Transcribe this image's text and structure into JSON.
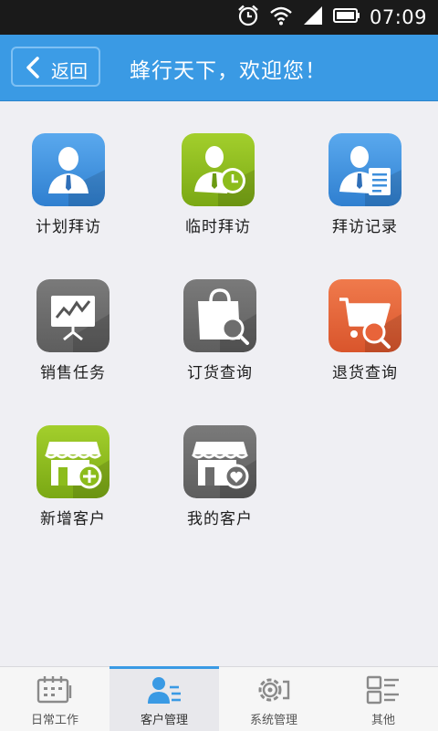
{
  "status_bar": {
    "time": "07:09",
    "icons": [
      "alarm-icon",
      "wifi-icon",
      "signal-icon",
      "battery-icon"
    ]
  },
  "header": {
    "back_label": "返回",
    "title": "蜂行天下，欢迎您！",
    "color": "#3a9ae4"
  },
  "tiles": [
    {
      "label": "计划拜访",
      "icon": "planned-visit-icon",
      "color": "#3d8fdc"
    },
    {
      "label": "临时拜访",
      "icon": "temporary-visit-icon",
      "color": "#8cbc1c"
    },
    {
      "label": "拜访记录",
      "icon": "visit-record-icon",
      "color": "#3d8fdc"
    },
    {
      "label": "销售任务",
      "icon": "sales-task-icon",
      "color": "#6d6d6d"
    },
    {
      "label": "订货查询",
      "icon": "order-query-icon",
      "color": "#6d6d6d"
    },
    {
      "label": "退货查询",
      "icon": "return-query-icon",
      "color": "#e8643a"
    },
    {
      "label": "新增客户",
      "icon": "add-customer-icon",
      "color": "#8cbc1c"
    },
    {
      "label": "我的客户",
      "icon": "my-customers-icon",
      "color": "#6d6d6d"
    }
  ],
  "bottom_nav": {
    "tabs": [
      {
        "label": "日常工作",
        "icon": "calendar-icon",
        "active": false
      },
      {
        "label": "客户管理",
        "icon": "customer-manage-icon",
        "active": true
      },
      {
        "label": "系统管理",
        "icon": "settings-icon",
        "active": false
      },
      {
        "label": "其他",
        "icon": "other-icon",
        "active": false
      }
    ],
    "active_color": "#3a9ae4"
  }
}
